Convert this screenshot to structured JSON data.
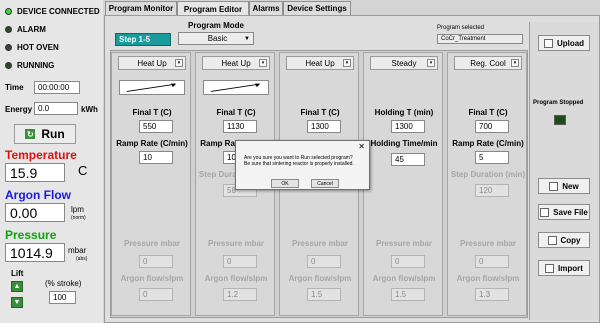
{
  "status": {
    "device_connected": "DEVICE CONNECTED",
    "alarm": "ALARM",
    "hot_oven": "HOT OVEN",
    "running": "RUNNING"
  },
  "time": {
    "label": "Time",
    "value": "00:00:00"
  },
  "energy": {
    "label": "Energy",
    "value": "0.0",
    "unit": "kWh"
  },
  "run_label": "Run",
  "temperature": {
    "label": "Temperature",
    "value": "15.9",
    "unit": "C"
  },
  "argon": {
    "label": "Argon Flow",
    "value": "0.00",
    "unit": "lpm",
    "sub": "(norm)"
  },
  "pressure": {
    "label": "Pressure",
    "value": "1014.9",
    "unit": "mbar",
    "sub": "(abs)"
  },
  "lift": {
    "label": "Lift",
    "stroke_label": "(% stroke)",
    "value": "100"
  },
  "tabs": [
    "Program Monitor",
    "Program Editor",
    "Alarms",
    "Device Settings"
  ],
  "step_range": "Step 1-5",
  "program_mode": {
    "label": "Program Mode",
    "value": "Basic"
  },
  "program_selected": {
    "label": "Program selected",
    "value": "CoCr_Treatment"
  },
  "steps": [
    {
      "type": "Heat Up",
      "field1_label": "Final T (C)",
      "field1": "550",
      "field2_label": "Ramp Rate (C/min)",
      "field2": "10",
      "pressure": "0",
      "argon": "0"
    },
    {
      "type": "Heat Up",
      "field1_label": "Final T (C)",
      "field1": "1130",
      "field2_label": "Ramp Rate (C/min)",
      "field2": "10",
      "dur_label": "Step Duration (min)",
      "dur": "58",
      "pressure": "0",
      "argon": "1.2"
    },
    {
      "type": "Heat Up",
      "field1_label": "Final T (C)",
      "field1": "1300",
      "pressure": "0",
      "argon": "1.5"
    },
    {
      "type": "Steady",
      "field1_label": "Holding T (min)",
      "field1": "1300",
      "field2_label": "Holding Time/min",
      "field2": "45",
      "pressure": "0",
      "argon": "1.5"
    },
    {
      "type": "Reg. Cool",
      "field1_label": "Final T (C)",
      "field1": "700",
      "field2_label": "Ramp Rate (C/min)",
      "field2": "5",
      "dur_label": "Step Duration (min)",
      "dur": "120",
      "pressure": "0",
      "argon": "1.3"
    }
  ],
  "pressure_label": "Pressure mbar",
  "argon_label": "Argon flow/slpm",
  "right": {
    "upload": "Upload",
    "program_status": "Program Stopped",
    "new": "New",
    "save_file": "Save File",
    "copy": "Copy",
    "import": "Import"
  },
  "dialog": {
    "line1": "Are you sure you want to Run selected program?",
    "line2": "Be sure that sintering reactor is properly installed.",
    "ok": "OK",
    "cancel": "Cancel",
    "close": "✕"
  }
}
